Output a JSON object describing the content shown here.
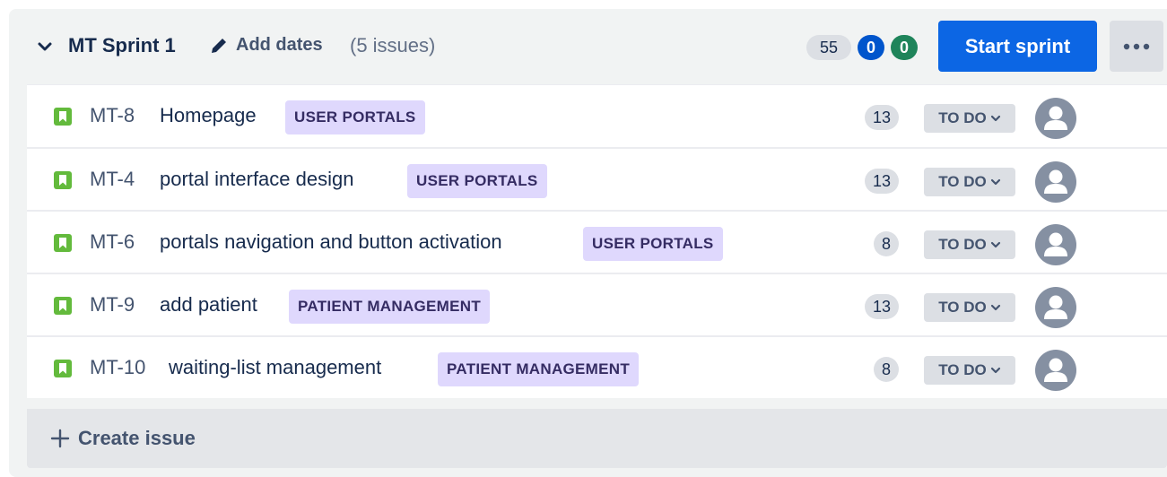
{
  "sprint": {
    "name": "MT Sprint 1",
    "add_dates_label": "Add dates",
    "issue_count_label": "(5 issues)",
    "counts": {
      "total": "55",
      "in_progress": "0",
      "done": "0"
    },
    "start_button_label": "Start sprint",
    "more_icon": "more-horizontal-icon"
  },
  "issues": [
    {
      "key": "MT-8",
      "summary": "Homepage",
      "epic": "USER PORTALS",
      "points": "13",
      "status": "TO DO"
    },
    {
      "key": "MT-4",
      "summary": "portal interface design",
      "epic": "USER PORTALS",
      "points": "13",
      "status": "TO DO"
    },
    {
      "key": "MT-6",
      "summary": "portals navigation and button activation",
      "epic": "USER PORTALS",
      "points": "8",
      "status": "TO DO"
    },
    {
      "key": "MT-9",
      "summary": "add patient",
      "epic": "PATIENT MANAGEMENT",
      "points": "13",
      "status": "TO DO"
    },
    {
      "key": "MT-10",
      "summary": "waiting-list management",
      "epic": "PATIENT MANAGEMENT",
      "points": "8",
      "status": "TO DO"
    }
  ],
  "create_issue_label": "Create issue",
  "colors": {
    "primary": "#0c66e4",
    "story_icon": "#63ba3c",
    "epic_bg": "#dfd8fd",
    "epic_text": "#352c63",
    "in_progress_badge": "#0055cc",
    "done_badge": "#1f845a"
  }
}
